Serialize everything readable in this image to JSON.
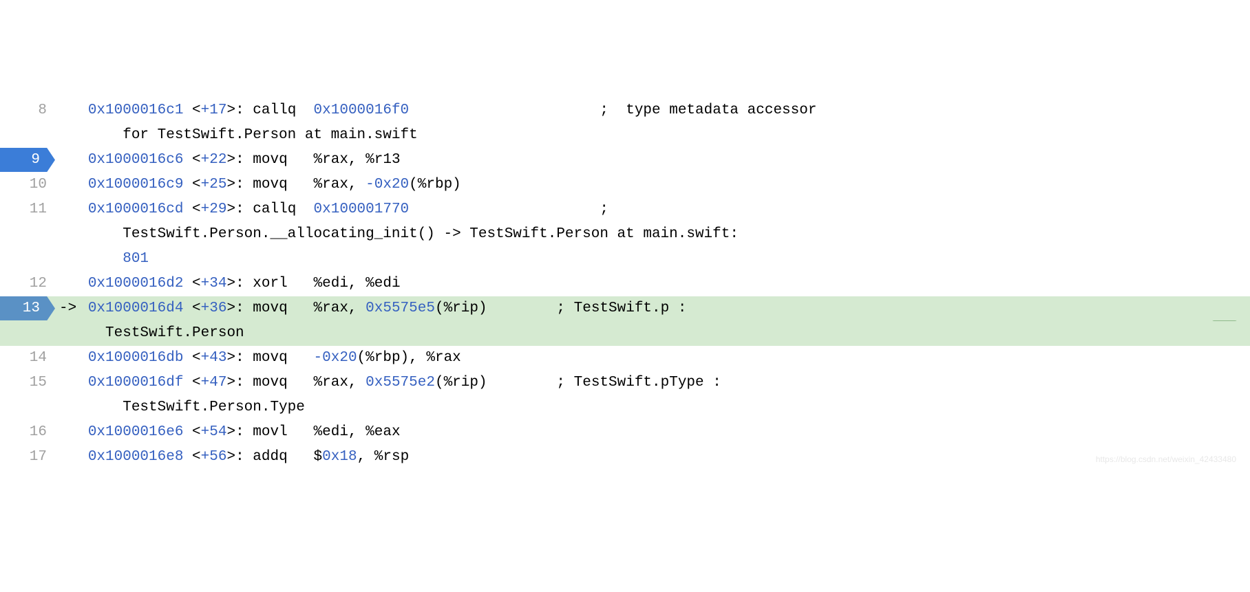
{
  "lines": [
    {
      "num": "8",
      "addr": "0x1000016c1",
      "offset": "+17",
      "mnemonic": "callq",
      "args_pre": "  ",
      "hex1": "0x1000016f0",
      "args_post": "                      ",
      "comment": ";  type metadata accessor",
      "wrap": "for TestSwift.Person at main.swift",
      "breakpoint": false,
      "current": false
    },
    {
      "num": "9",
      "addr": "0x1000016c6",
      "offset": "+22",
      "mnemonic": "movq",
      "args_pre": "   %rax, %r13",
      "breakpoint": true,
      "current": false
    },
    {
      "num": "10",
      "addr": "0x1000016c9",
      "offset": "+25",
      "mnemonic": "movq",
      "args_pre": "   %rax, ",
      "hex1": "-0x20",
      "args_post": "(%rbp)",
      "breakpoint": false,
      "current": false
    },
    {
      "num": "11",
      "addr": "0x1000016cd",
      "offset": "+29",
      "mnemonic": "callq",
      "args_pre": "  ",
      "hex1": "0x100001770",
      "args_post": "                      ",
      "comment": "; ",
      "wrap": "TestSwift.Person.__allocating_init() -> TestSwift.Person at main.swift:",
      "wrap2": "801",
      "wrap2_is_num": true,
      "breakpoint": false,
      "current": false
    },
    {
      "num": "12",
      "addr": "0x1000016d2",
      "offset": "+34",
      "mnemonic": "xorl",
      "args_pre": "   %edi, %edi",
      "breakpoint": false,
      "current": false
    },
    {
      "num": "13",
      "addr": "0x1000016d4",
      "offset": "+36",
      "mnemonic": "movq",
      "args_pre": "   %rax, ",
      "hex1": "0x5575e5",
      "args_post": "(%rip)        ",
      "comment": "; TestSwift.p :",
      "wrap": "TestSwift.Person",
      "wrap_indent_short": true,
      "breakpoint": true,
      "current": true
    },
    {
      "num": "14",
      "addr": "0x1000016db",
      "offset": "+43",
      "mnemonic": "movq",
      "args_pre": "   ",
      "hex1": "-0x20",
      "args_post": "(%rbp), %rax",
      "breakpoint": false,
      "current": false
    },
    {
      "num": "15",
      "addr": "0x1000016df",
      "offset": "+47",
      "mnemonic": "movq",
      "args_pre": "   %rax, ",
      "hex1": "0x5575e2",
      "args_post": "(%rip)        ",
      "comment": "; TestSwift.pType :",
      "wrap": "TestSwift.Person.Type",
      "breakpoint": false,
      "current": false
    },
    {
      "num": "16",
      "addr": "0x1000016e6",
      "offset": "+54",
      "mnemonic": "movl",
      "args_pre": "   %edi, %eax",
      "breakpoint": false,
      "current": false
    },
    {
      "num": "17",
      "addr": "0x1000016e8",
      "offset": "+56",
      "mnemonic": "addq",
      "args_pre": "   $",
      "hex1": "0x18",
      "args_post": ", %rsp",
      "breakpoint": false,
      "current": false
    }
  ],
  "arrow": "->",
  "watermark": "https://blog.csdn.net/weixin_42433480"
}
